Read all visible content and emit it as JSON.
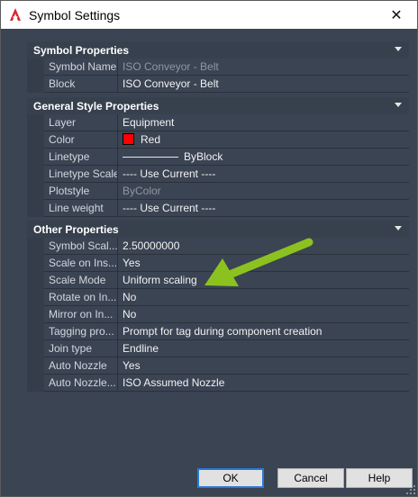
{
  "window": {
    "title": "Symbol Settings",
    "close_glyph": "✕",
    "app_icon": "autocad-icon"
  },
  "sections": [
    {
      "title": "Symbol Properties",
      "rows": [
        {
          "name": "Symbol Name",
          "value": "ISO Conveyor - Belt",
          "dim": true
        },
        {
          "name": "Block",
          "value": "ISO Conveyor - Belt",
          "dim": false
        }
      ]
    },
    {
      "title": "General Style Properties",
      "rows": [
        {
          "name": "Layer",
          "value": "Equipment",
          "dim": false
        },
        {
          "name": "Color",
          "value": "Red",
          "dim": false,
          "swatch": "#ff0000"
        },
        {
          "name": "Linetype",
          "value": "ByBlock",
          "dim": false,
          "linetype": true
        },
        {
          "name": "Linetype Scale",
          "value": "---- Use Current ----",
          "dim": false
        },
        {
          "name": "Plotstyle",
          "value": "ByColor",
          "dim": true
        },
        {
          "name": "Line weight",
          "value": "---- Use Current ----",
          "dim": false
        }
      ]
    },
    {
      "title": "Other Properties",
      "rows": [
        {
          "name": "Symbol Scal...",
          "value": "2.50000000",
          "dim": false
        },
        {
          "name": "Scale on Ins...",
          "value": "Yes",
          "dim": false
        },
        {
          "name": "Scale Mode",
          "value": "Uniform scaling",
          "dim": false
        },
        {
          "name": "Rotate on In...",
          "value": "No",
          "dim": false
        },
        {
          "name": "Mirror on In...",
          "value": "No",
          "dim": false
        },
        {
          "name": "Tagging pro...",
          "value": "Prompt for tag during component creation",
          "dim": false
        },
        {
          "name": "Join type",
          "value": "Endline",
          "dim": false
        },
        {
          "name": "Auto Nozzle",
          "value": "Yes",
          "dim": false
        },
        {
          "name": "Auto Nozzle...",
          "value": "ISO Assumed Nozzle",
          "dim": false
        }
      ]
    }
  ],
  "buttons": {
    "ok": "OK",
    "cancel": "Cancel",
    "help": "Help"
  },
  "colors": {
    "accent_arrow": "#8cc21f",
    "dialog_bg": "#3b4453",
    "color_swatch": "#ff0000"
  }
}
